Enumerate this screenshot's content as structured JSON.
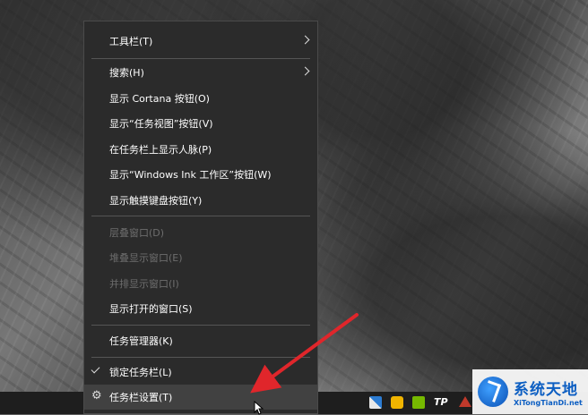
{
  "menu": {
    "items": [
      {
        "label": "工具栏(T)",
        "type": "submenu"
      },
      {
        "label": "搜索(H)",
        "type": "submenu"
      },
      {
        "label": "显示 Cortana 按钮(O)",
        "type": "normal"
      },
      {
        "label": "显示“任务视图”按钮(V)",
        "type": "normal"
      },
      {
        "label": "在任务栏上显示人脉(P)",
        "type": "normal"
      },
      {
        "label": "显示“Windows Ink 工作区”按钮(W)",
        "type": "normal"
      },
      {
        "label": "显示触摸键盘按钮(Y)",
        "type": "normal"
      },
      {
        "label": "层叠窗口(D)",
        "type": "disabled"
      },
      {
        "label": "堆叠显示窗口(E)",
        "type": "disabled"
      },
      {
        "label": "并排显示窗口(I)",
        "type": "disabled"
      },
      {
        "label": "显示打开的窗口(S)",
        "type": "normal"
      },
      {
        "label": "任务管理器(K)",
        "type": "normal"
      },
      {
        "label": "锁定任务栏(L)",
        "type": "checked"
      },
      {
        "label": "任务栏设置(T)",
        "type": "settings",
        "highlighted": true
      }
    ]
  },
  "tray": {
    "icons": [
      "windows-defender-icon",
      "norton-icon",
      "nvidia-icon",
      "tp-icon",
      "network-warning-icon"
    ],
    "tp_text": "TP"
  },
  "annotation": {
    "arrow_color": "#e0262b"
  },
  "watermark": {
    "title": "系统天地",
    "url": "XiTongTianDi.net"
  }
}
